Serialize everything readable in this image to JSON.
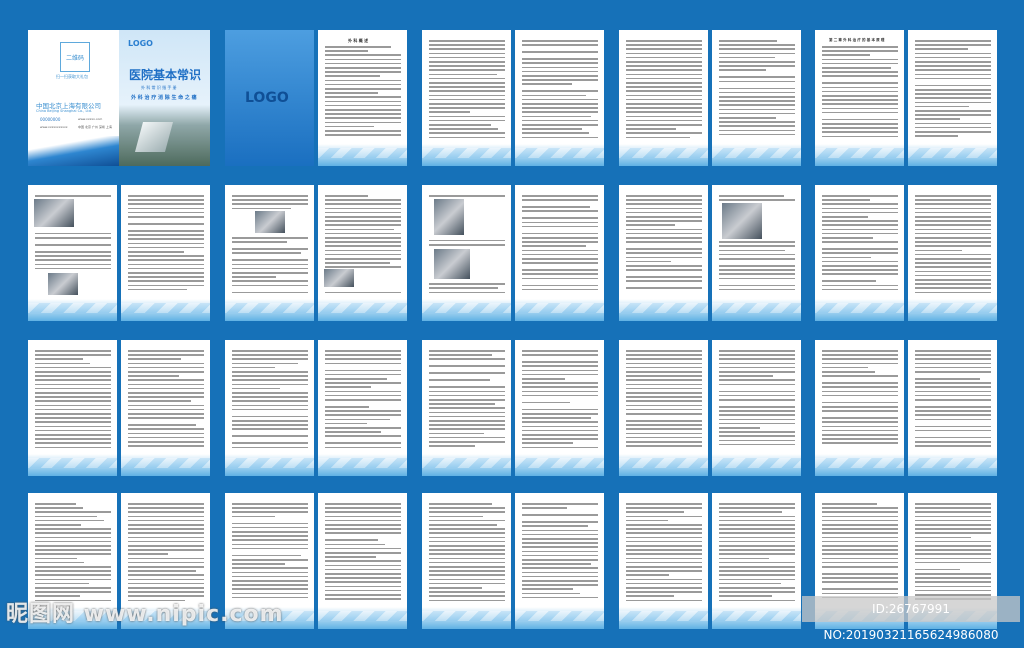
{
  "cover": {
    "qr_label": "二维码",
    "qr_caption": "扫一扫获取大礼包",
    "company_cn": "中国北京上海有限公司",
    "company_en": "China Beijing Shanghai Co., Ltd.",
    "phone": "00000000",
    "website": "www.xxxxx.com",
    "email": "www.xxxxxxxxxxx",
    "cities": "中国 北京 广州 深圳 上海",
    "logo": "LOGO",
    "title": "医院基本常识",
    "subtitle": "外 科 常 识 指 手 册",
    "slogan": "外 科 治 疗  消 除 生 命 之 痛"
  },
  "inner_cover": {
    "logo": "LOGO"
  },
  "headings": {
    "p1": "外 科 概 述",
    "p1_sub": "外 科 的 基 本 范 畴",
    "p5": "第 二 章  外 科 治 疗 的 基 本 原 理",
    "p5_sub": "外 科 的 基 本 治 疗 方 式"
  },
  "watermark": {
    "site": "昵图网 www.nipic.com",
    "id": "ID:26767991 NO:20190321165624986080"
  }
}
